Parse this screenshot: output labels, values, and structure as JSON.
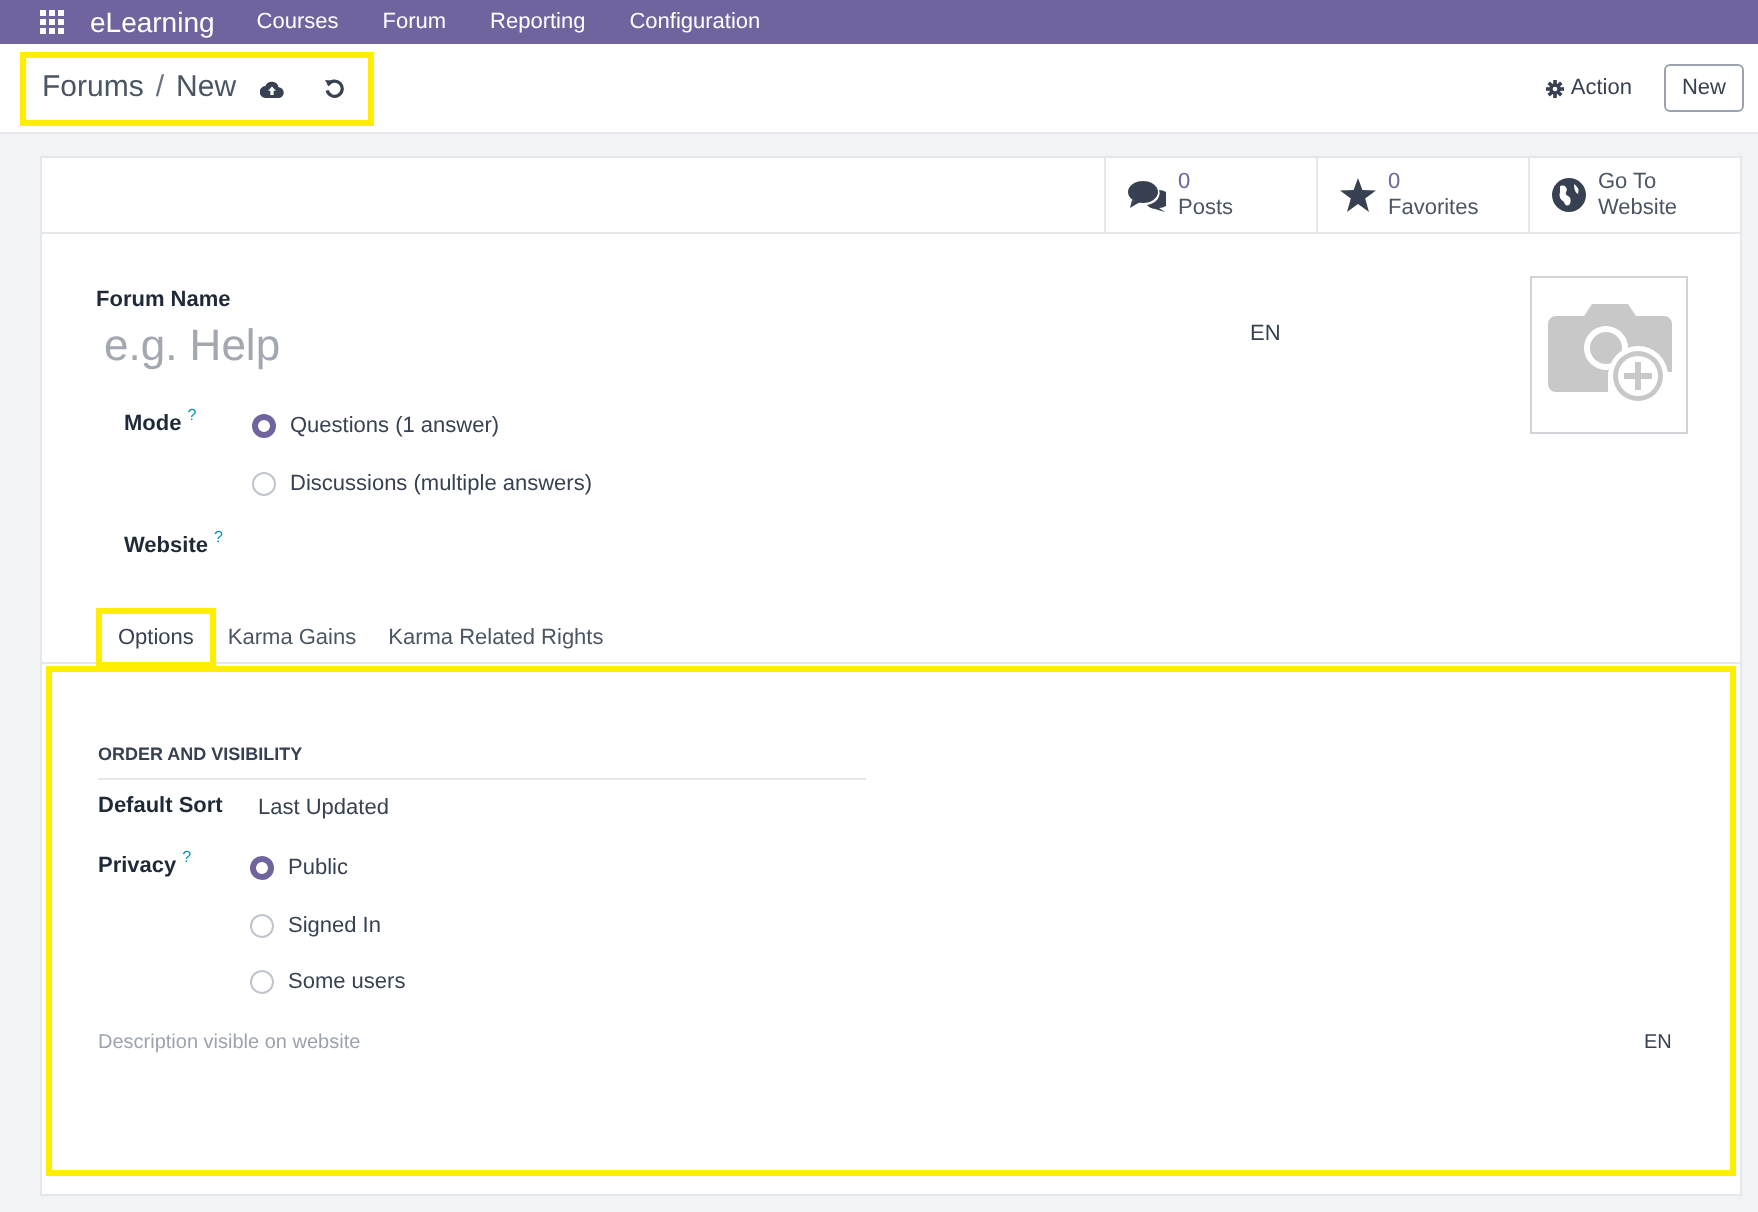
{
  "navbar": {
    "app": "eLearning",
    "menu": [
      "Courses",
      "Forum",
      "Reporting",
      "Configuration"
    ]
  },
  "control_panel": {
    "breadcrumb": [
      "Forums",
      "New"
    ],
    "separator": "/",
    "highlighted": true,
    "action": "Action",
    "new_button": "New"
  },
  "stat_buttons": [
    {
      "kind": "posts",
      "value": "0",
      "label": "Posts"
    },
    {
      "kind": "favorites",
      "value": "0",
      "label": "Favorites"
    },
    {
      "kind": "website",
      "label": "Go To Website"
    }
  ],
  "form": {
    "name_label": "Forum Name",
    "name_placeholder": "e.g. Help",
    "lang": "EN",
    "mode": {
      "label": "Mode",
      "help": "?",
      "options": [
        {
          "label": "Questions (1 answer)",
          "selected": true
        },
        {
          "label": "Discussions (multiple answers)",
          "selected": false
        }
      ]
    },
    "website": {
      "label": "Website",
      "help": "?"
    }
  },
  "tabs": [
    {
      "label": "Options",
      "selected": true,
      "highlighted": true
    },
    {
      "label": "Karma Gains",
      "selected": false,
      "highlighted": false
    },
    {
      "label": "Karma Related Rights",
      "selected": false,
      "highlighted": false
    }
  ],
  "options_panel": {
    "highlighted": true,
    "section": "ORDER AND VISIBILITY",
    "default_sort": {
      "label": "Default Sort",
      "value": "Last Updated"
    },
    "privacy": {
      "label": "Privacy",
      "help": "?",
      "options": [
        {
          "label": "Public",
          "selected": true
        },
        {
          "label": "Signed In",
          "selected": false
        },
        {
          "label": "Some users",
          "selected": false
        }
      ]
    },
    "description_placeholder": "Description visible on website",
    "lang": "EN"
  }
}
